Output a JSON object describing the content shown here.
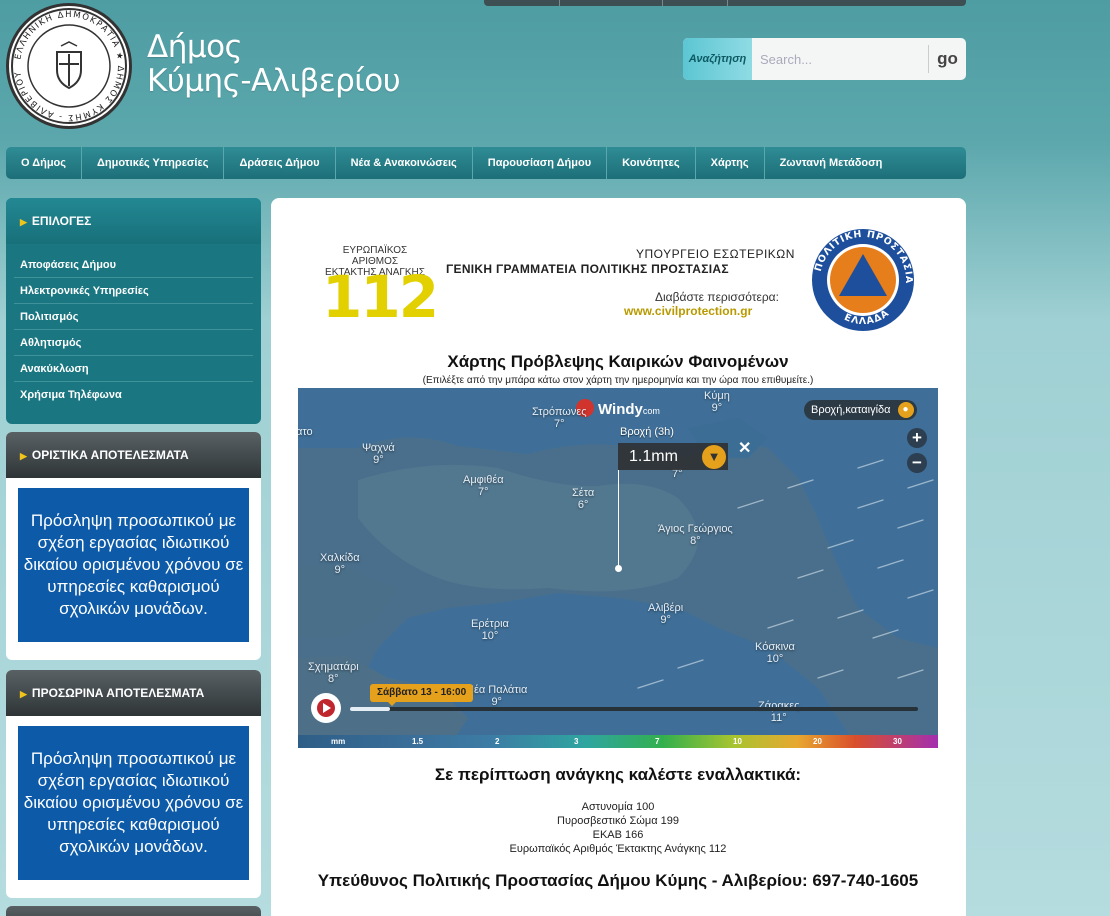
{
  "site": {
    "title_line1": "Δήμος",
    "title_line2": "Κύμης-Αλιβερίου",
    "seal_text": "ΕΛΛΗΝΙΚΗ ΔΗΜΟΚΡΑΤΙΑ ΔΗΜΟΣ ΚΥΜΗΣ - ΑΛΙΒΕΡΙΟΥ"
  },
  "search": {
    "label": "Αναζήτηση",
    "placeholder": "Search...",
    "go_label": "go"
  },
  "nav": {
    "items": [
      "Ο Δήμος",
      "Δημοτικές Υπηρεσίες",
      "Δράσεις Δήμου",
      "Νέα & Ανακοινώσεις",
      "Παρουσίαση Δήμου",
      "Κοινότητες",
      "Χάρτης",
      "Ζωντανή Μετάδοση"
    ]
  },
  "sidebar": {
    "options_title": "ΕΠΙΛΟΓΕΣ",
    "options": [
      "Αποφάσεις Δήμου",
      "Ηλεκτρονικές Υπηρεσίες",
      "Πολιτισμός",
      "Αθλητισμός",
      "Ανακύκλωση",
      "Χρήσιμα Τηλέφωνα"
    ],
    "final_results_title": "ΟΡΙΣΤΙΚΑ ΑΠΟΤΕΛΕΣΜΑΤΑ",
    "final_results_text": "Πρόσληψη προσωπικού με σχέση εργασίας ιδιωτικού δικαίου ορισμένου χρόνου σε υπηρεσίες καθαρισμού σχολικών μονάδων.",
    "temp_results_title": "ΠΡΟΣΩΡΙΝΑ ΑΠΟΤΕΛΕΣΜΑΤΑ",
    "temp_results_text": "Πρόσληψη προσωπικού με σχέση εργασίας ιδιωτικού δικαίου ορισμένου χρόνου σε υπηρεσίες καθαρισμού σχολικών μονάδων."
  },
  "banner": {
    "eu_number_line1": "ΕΥΡΩΠΑΪΚΟΣ ΑΡΙΘΜΟΣ",
    "eu_number_line2": "ΕΚΤΑΚΤΗΣ ΑΝΑΓΚΗΣ",
    "number": "112",
    "ministry": "ΥΠΟΥΡΓΕΙΟ ΕΣΩΤΕΡΙΚΩΝ",
    "secretariat": "ΓΕΝΙΚΗ ΓΡΑΜΜΑΤΕΙΑ ΠΟΛΙΤΙΚΗΣ ΠΡΟΣΤΑΣΙΑΣ",
    "read_more": "Διαβάστε περισσότερα:",
    "website": "www.civilprotection.gr",
    "logo_text": "ΠΟΛΙΤΙΚΗ ΠΡΟΣΤΑΣΙΑ ΕΛΛΑΔΑ"
  },
  "map": {
    "title": "Χάρτης Πρόβλεψης Καιρικών Φαινομένων",
    "subtitle": "(Επιλέξτε από την μπάρα κάτω στον χάρτη την ημερομηνία και την ώρα που επιθυμείτε.)",
    "brand": "Windy",
    "brand_suffix": "com",
    "layer": "Βροχή,καταιγίδα",
    "popup_title": "Βροχή (3h)",
    "popup_value": "1.1mm",
    "time_label": "Σάββατο 13 - 16:00",
    "timeline_progress": 0.07,
    "scale_unit": "mm",
    "scale_ticks": [
      "1.5",
      "2",
      "3",
      "7",
      "10",
      "20",
      "30"
    ],
    "places": [
      {
        "name": "Στρόπωνες",
        "temp": "7°"
      },
      {
        "name": "Κύμη",
        "temp": "9°"
      },
      {
        "name": "ατο",
        "temp": ""
      },
      {
        "name": "Ψαχνά",
        "temp": "9°"
      },
      {
        "name": "Αμφιθέα",
        "temp": "7°"
      },
      {
        "name": "Σέτα",
        "temp": "6°"
      },
      {
        "name": "Άγιος Γεώργιος",
        "temp": "8°"
      },
      {
        "name": "Χαλκίδα",
        "temp": "9°"
      },
      {
        "name": "Αλιβέρι",
        "temp": "9°"
      },
      {
        "name": "Ερέτρια",
        "temp": "10°"
      },
      {
        "name": "Κόσκινα",
        "temp": "10°"
      },
      {
        "name": "Σχηματάρι",
        "temp": "8°"
      },
      {
        "name": "Νέα Παλάτια",
        "temp": "9°"
      },
      {
        "name": "Ζάρακες",
        "temp": "11°"
      },
      {
        "name": "",
        "temp": "7°"
      }
    ]
  },
  "emergency": {
    "title": "Σε περίπτωση ανάγκης καλέστε εναλλακτικά:",
    "lines": [
      "Αστυνομία 100",
      "Πυροσβεστικό Σώμα 199",
      "ΕΚΑΒ 166",
      "Ευρωπαϊκός Αριθμός Έκτακτης Ανάγκης 112"
    ],
    "responsible": "Υπεύθυνος Πολιτικής Προστασίας Δήμου Κύμης - Αλιβερίου: 697-740-1605"
  },
  "colors": {
    "nav": "#1d6f78",
    "card": "#0c5aa8",
    "accent": "#e6a11c",
    "number_112": "#e2d000"
  }
}
